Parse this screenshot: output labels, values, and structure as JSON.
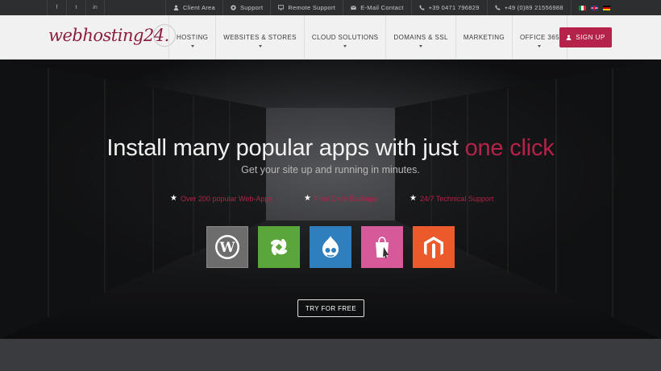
{
  "topbar": {
    "social": [
      "facebook-icon",
      "twitter-icon",
      "linkedin-icon"
    ],
    "social_glyphs": [
      "f",
      "t",
      "in"
    ],
    "links": [
      {
        "label": "Client Area",
        "icon": "user-icon"
      },
      {
        "label": "Support",
        "icon": "lifebuoy-icon"
      },
      {
        "label": "Remote Support",
        "icon": "screen-share-icon"
      },
      {
        "label": "E-Mail Contact",
        "icon": "envelope-icon"
      },
      {
        "label": "+39 0471 796829",
        "icon": "phone-icon"
      },
      {
        "label": "+49 (0)89 21556988",
        "icon": "phone-icon"
      }
    ],
    "languages": [
      "it",
      "en",
      "de"
    ]
  },
  "header": {
    "logo_text": "webhosting24.",
    "nav": [
      "HOSTING",
      "WEBSITES & STORES",
      "CLOUD SOLUTIONS",
      "DOMAINS & SSL",
      "MARKETING",
      "OFFICE 365"
    ],
    "signup_label": "SIGN UP"
  },
  "hero": {
    "title_main": "Install many popular apps with just ",
    "title_accent": "one click",
    "subtitle": "Get your site up and running in minutes.",
    "features": [
      "Over 200 popular Web-Apps",
      "Free Daily Backups",
      "24/7 Technical Support"
    ],
    "apps": [
      {
        "name": "WordPress",
        "color": "#6d6d6d"
      },
      {
        "name": "Joomla",
        "color": "#5aa63a"
      },
      {
        "name": "Drupal",
        "color": "#2f7fbf"
      },
      {
        "name": "PrestaShop",
        "color": "#d65a9a"
      },
      {
        "name": "Magento",
        "color": "#ea5a2a"
      }
    ],
    "cta_label": "TRY FOR FREE"
  },
  "colors": {
    "accent": "#b5224a",
    "topbar": "#2d2e30",
    "header": "#f1f1f1"
  }
}
